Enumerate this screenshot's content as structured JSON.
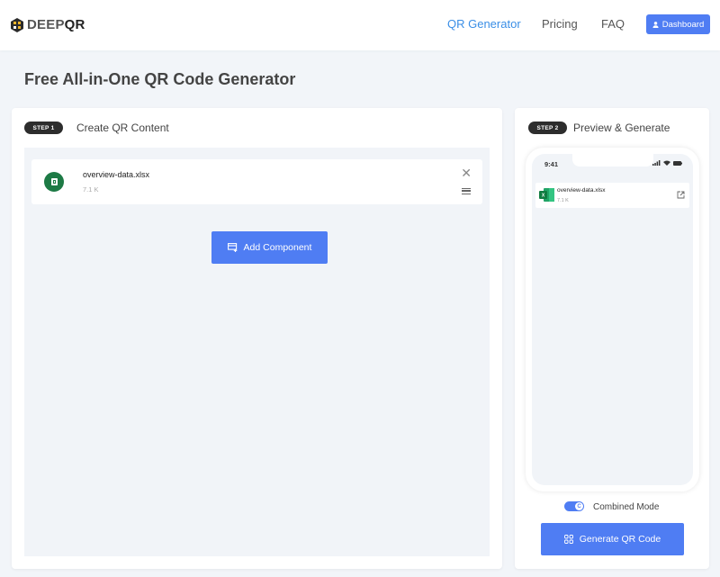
{
  "header": {
    "logo": {
      "prefix": "DEEP",
      "suffix": "QR"
    },
    "nav": [
      {
        "label": "QR Generator",
        "active": true
      },
      {
        "label": "Pricing",
        "active": false
      },
      {
        "label": "FAQ",
        "active": false
      }
    ],
    "dashboard_label": "Dashboard",
    "icons": {
      "dashboard": "user-icon"
    }
  },
  "page": {
    "title": "Free All-in-One QR Code Generator"
  },
  "step1": {
    "badge": "STEP 1",
    "title": "Create QR Content",
    "components": [
      {
        "type": "file",
        "name": "overview-data.xlsx",
        "size": "7.1 K",
        "icon": "spreadsheet-icon"
      }
    ],
    "add_component_label": "Add Component"
  },
  "step2": {
    "badge": "STEP 2",
    "title": "Preview & Generate",
    "phone": {
      "time": "9:41",
      "file": {
        "name": "overview-data.xlsx",
        "size": "7.1 K"
      }
    },
    "combined_mode": {
      "label": "Combined Mode",
      "enabled": true,
      "knob_glyph": "C"
    },
    "generate_label": "Generate QR Code"
  },
  "colors": {
    "accent": "#4f7df3",
    "nav_active": "#3a8ee6",
    "file_green": "#1d7a45",
    "background": "#f2f5f9"
  }
}
